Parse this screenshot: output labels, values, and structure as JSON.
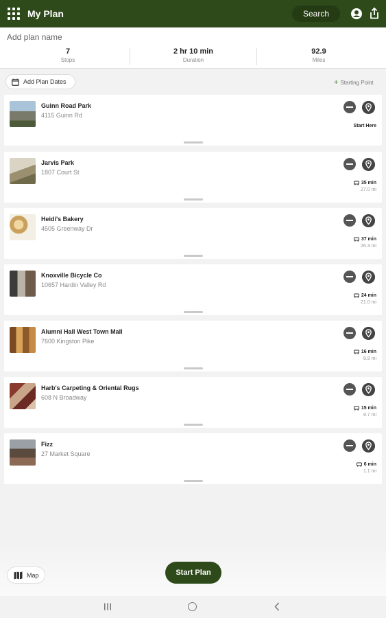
{
  "app": {
    "title": "My Plan",
    "search_label": "Search"
  },
  "plan": {
    "name_placeholder": "Add plan name",
    "stats": [
      {
        "value": "7",
        "label": "Stops"
      },
      {
        "value": "2 hr 10 min",
        "label": "Duration"
      },
      {
        "value": "92.9",
        "label": "Miles"
      }
    ]
  },
  "actions": {
    "add_dates": "Add Plan Dates",
    "starting_point": "Starting Point"
  },
  "stops": [
    {
      "name": "Guinn Road Park",
      "address": "4115 Guinn Rd",
      "start_label": "Start Here",
      "time": "",
      "distance": ""
    },
    {
      "name": "Jarvis Park",
      "address": "1807 Court St",
      "start_label": "",
      "time": "35 min",
      "distance": "27.0 mi"
    },
    {
      "name": "Heidi's Bakery",
      "address": "4505 Greenway Dr",
      "start_label": "",
      "time": "37 min",
      "distance": "26.3 mi"
    },
    {
      "name": "Knoxville Bicycle Co",
      "address": "10657 Hardin Valley Rd",
      "start_label": "",
      "time": "24 min",
      "distance": "21.0 mi"
    },
    {
      "name": "Alumni Hall West Town Mall",
      "address": "7600 Kingston Pike",
      "start_label": "",
      "time": "16 min",
      "distance": "8.9 mi"
    },
    {
      "name": "Harb's Carpeting & Oriental Rugs",
      "address": "608 N Broadway",
      "start_label": "",
      "time": "15 min",
      "distance": "8.7 mi"
    },
    {
      "name": "Fizz",
      "address": "27 Market Square",
      "start_label": "",
      "time": "6 min",
      "distance": "1.1 mi"
    }
  ],
  "footer": {
    "map_label": "Map",
    "start_plan_label": "Start Plan"
  },
  "colors": {
    "primary": "#2e4a1a",
    "accent": "#4b7a30"
  }
}
